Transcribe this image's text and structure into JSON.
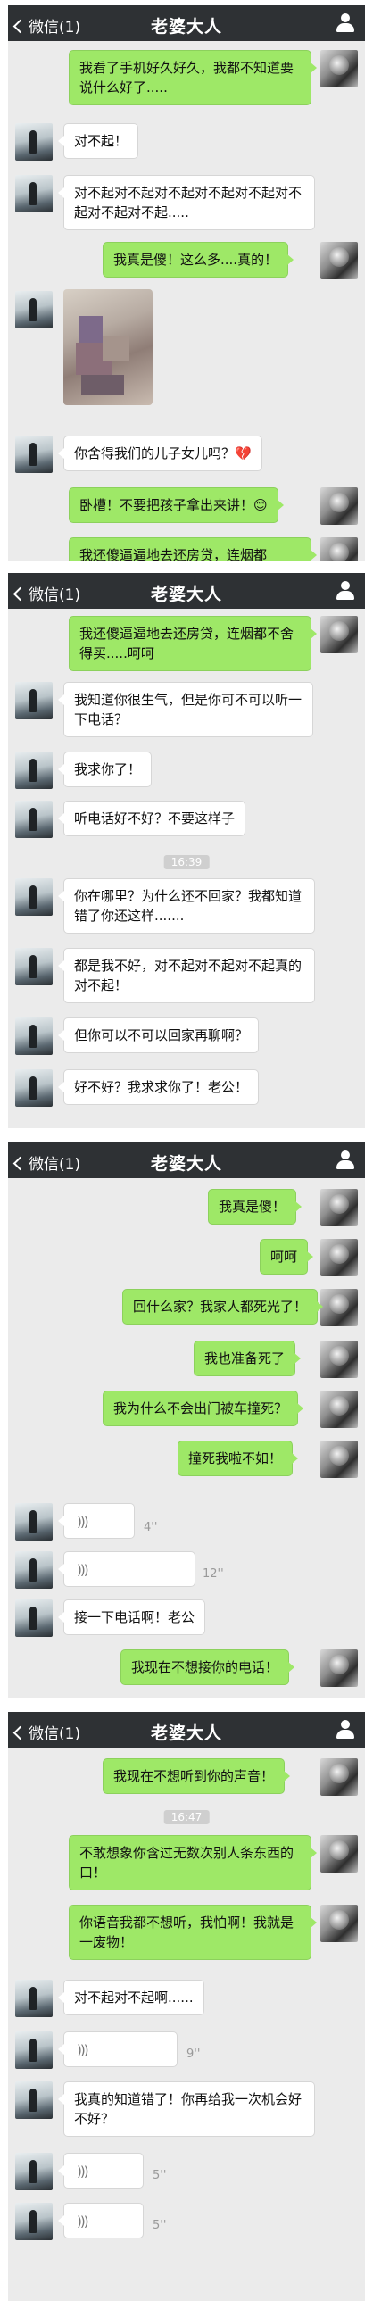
{
  "header": {
    "back_label": "微信(1)",
    "title": "老婆大人"
  },
  "panel1": {
    "m1": "我看了手机好久好久，我都不知道要说什么好了.....",
    "m2": "对不起！",
    "m3": "对不起对不起对不起对不起对不起对不起对不起对不起.....",
    "m4": "我真是傻！这么多....真的！",
    "m5": "你舍得我们的儿子女儿吗？",
    "m5_emoji": "💔",
    "m6": "卧槽！不要把孩子拿出来讲！",
    "m6_emoji": "😊",
    "m7": "我还傻逼逼地去还房贷，连烟都"
  },
  "panel2": {
    "m1": "我还傻逼逼地去还房贷，连烟都不舍得买.....呵呵",
    "m2": "我知道你很生气，但是你可不可以听一下电话？",
    "m3": "我求你了！",
    "m4": "听电话好不好？不要这样子",
    "time": "16:39",
    "m5": "你在哪里？为什么还不回家？我都知道错了你还这样.......",
    "m6": "都是我不好，对不起对不起对不起真的对不起！",
    "m7": "但你可以不可以回家再聊啊？",
    "m8": "好不好？我求求你了！老公！"
  },
  "panel3": {
    "m1": "我真是傻！",
    "m2": "呵呵",
    "m3": "回什么家？我家人都死光了！",
    "m4": "我也准备死了",
    "m5": "我为什么不会出门被车撞死？",
    "m6": "撞死我啦不如！",
    "v1": "4''",
    "v2": "12''",
    "m7": "接一下电话啊！老公",
    "m8": "我现在不想接你的电话！"
  },
  "panel4": {
    "m1": "我现在不想听到你的声音！",
    "time": "16:47",
    "m2": "不敢想象你含过无数次别人条东西的口！",
    "m3": "你语音我都不想听，我怕啊！我就是一废物！",
    "m4": "对不起对不起啊......",
    "v1": "9''",
    "m5": "我真的知道错了！你再给我一次机会好不好？",
    "v2": "5''",
    "v3": "5''"
  },
  "colors": {
    "header_bg": "#2e3134",
    "chat_bg": "#ebebeb",
    "sent_bubble": "#9ee867",
    "recv_bubble": "#ffffff"
  },
  "icons": {
    "back": "chevron-left-icon",
    "contact": "person-icon",
    "voice": "voice-wave-icon"
  }
}
